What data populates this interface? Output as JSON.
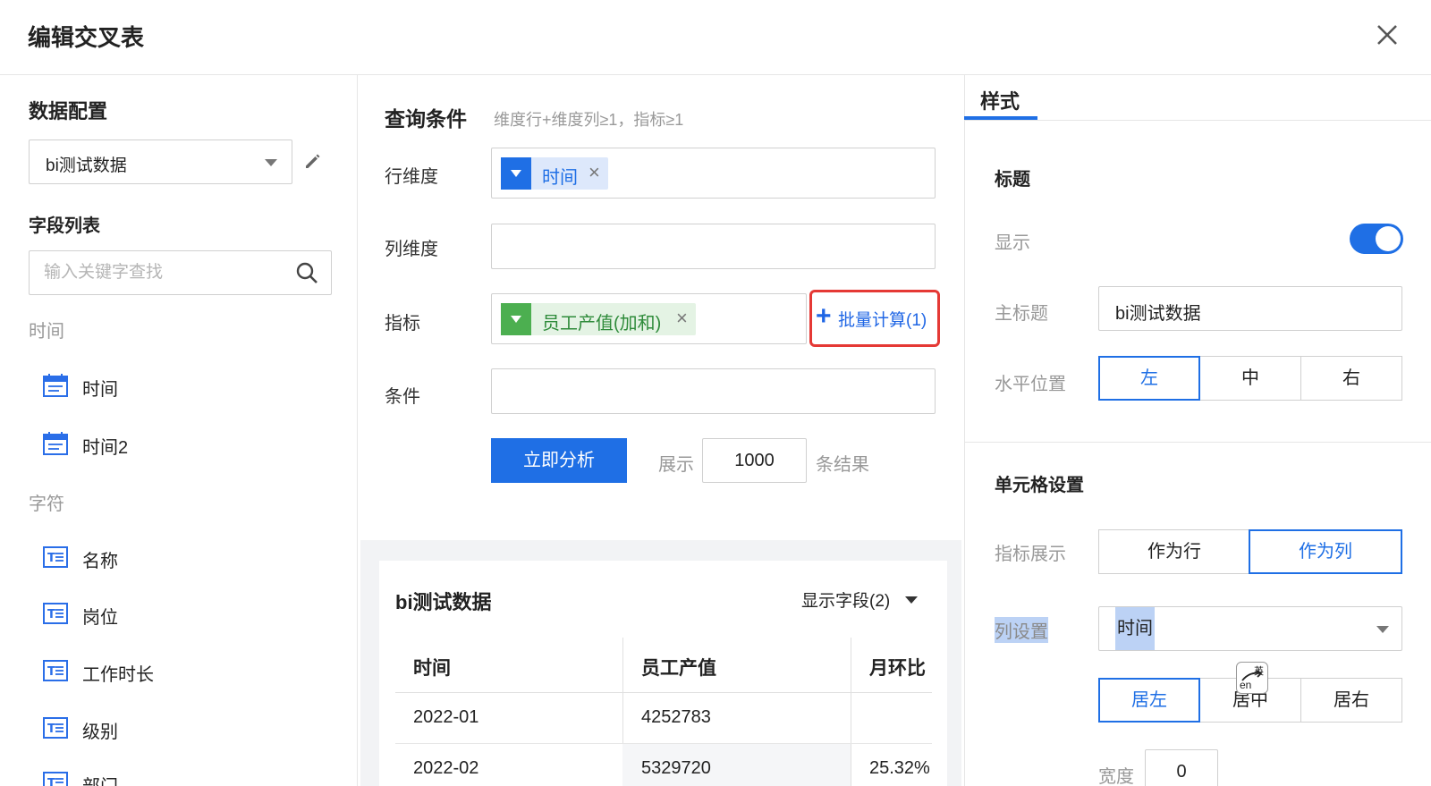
{
  "dialog": {
    "title": "编辑交叉表"
  },
  "left": {
    "title": "数据配置",
    "dataset": "bi测试数据",
    "fields_title": "字段列表",
    "search_placeholder": "输入关键字查找",
    "groups": [
      {
        "label": "时间",
        "items": [
          "时间",
          "时间2"
        ]
      },
      {
        "label": "字符",
        "items": [
          "名称",
          "岗位",
          "工作时长",
          "级别",
          "部门"
        ]
      }
    ]
  },
  "query": {
    "title": "查询条件",
    "hint": "维度行+维度列≥1，指标≥1",
    "row_dim_label": "行维度",
    "row_dim_tag": "时间",
    "col_dim_label": "列维度",
    "metric_label": "指标",
    "metric_tag": "员工产值(加和)",
    "batch_label": "批量计算(1)",
    "condition_label": "条件",
    "analyze_label": "立即分析",
    "show_label": "展示",
    "limit_value": "1000",
    "result_suffix": "条结果",
    "remove_glyph": "×"
  },
  "preview": {
    "title": "bi测试数据",
    "show_fields": "显示字段(2)",
    "columns": [
      "时间",
      "员工产值",
      "月环比"
    ],
    "rows": [
      [
        "2022-01",
        "4252783",
        ""
      ],
      [
        "2022-02",
        "5329720",
        "25.32%"
      ]
    ]
  },
  "style": {
    "tab_label": "样式",
    "title_section": "标题",
    "show_label": "显示",
    "show_enabled": true,
    "main_title_label": "主标题",
    "main_title_value": "bi测试数据",
    "h_position_label": "水平位置",
    "h_positions": [
      "左",
      "中",
      "右"
    ],
    "h_position_selected": "左",
    "cell_section": "单元格设置",
    "metric_display_label": "指标展示",
    "metric_display_options": [
      "作为行",
      "作为列"
    ],
    "metric_display_selected": "作为列",
    "col_setting_label": "列设置",
    "col_setting_value": "时间",
    "align_options": [
      "居左",
      "居中",
      "居右"
    ],
    "align_selected": "居左",
    "width_label": "宽度",
    "width_value": "0"
  },
  "ime": {
    "top": "英",
    "bottom": "en"
  },
  "colors": {
    "accent": "#1f6fe5",
    "metric_green": "#4caf50",
    "highlight_red": "#e53935"
  }
}
